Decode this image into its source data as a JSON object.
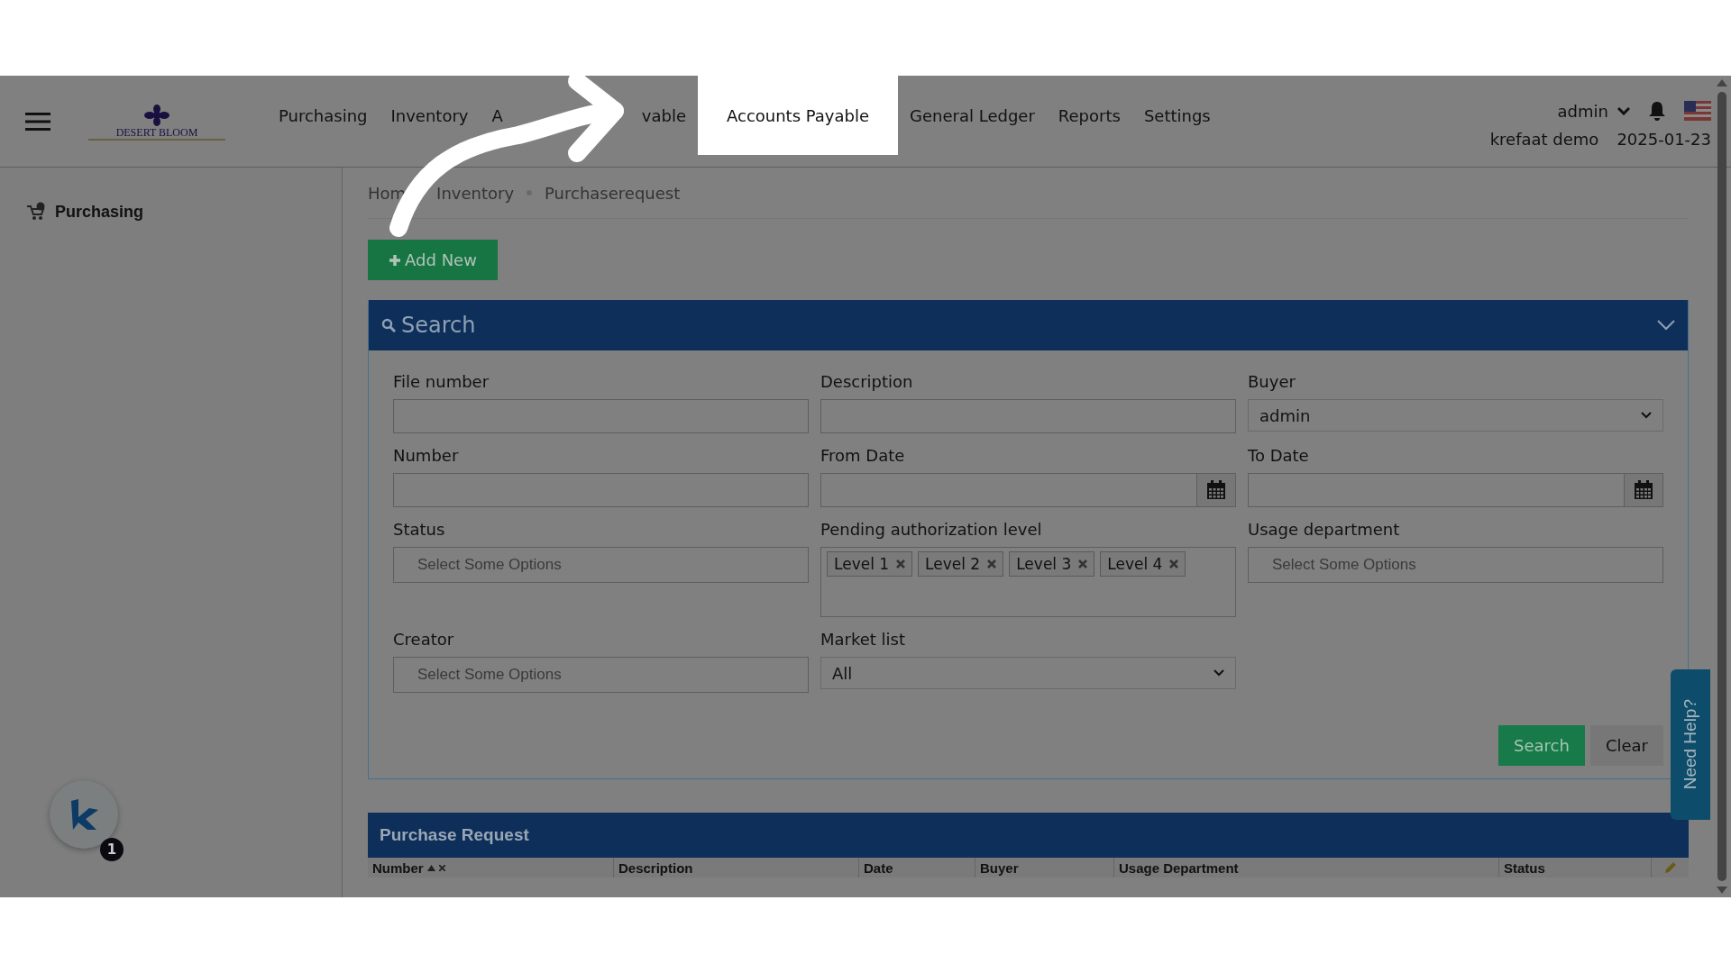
{
  "header": {
    "logo_text": "DESERT BLOOM",
    "nav": [
      {
        "kind": "item",
        "label": "Purchasing",
        "highlighted": false
      },
      {
        "kind": "item",
        "label": "Inventory",
        "highlighted": false
      },
      {
        "kind": "partial",
        "parts": [
          "A",
          "vable"
        ],
        "highlighted": false
      },
      {
        "kind": "item",
        "label": "Accounts Payable",
        "highlighted": true
      },
      {
        "kind": "item",
        "label": "General Ledger",
        "highlighted": false
      },
      {
        "kind": "item",
        "label": "Reports",
        "highlighted": false
      },
      {
        "kind": "item",
        "label": "Settings",
        "highlighted": false
      }
    ],
    "user": "admin",
    "company": "krefaat demo",
    "date": "2025-01-23"
  },
  "sidebar": {
    "items": [
      {
        "label": "Purchasing"
      }
    ],
    "widget_badge": "1"
  },
  "breadcrumb": [
    "Hom",
    "Inventory",
    "Purchaserequest"
  ],
  "add_button": "Add New",
  "search_panel": {
    "title": "Search",
    "fields": [
      {
        "label": "File number",
        "kind": "text"
      },
      {
        "label": "Description",
        "kind": "text"
      },
      {
        "label": "Buyer",
        "kind": "select",
        "value": "admin"
      },
      {
        "label": "Number",
        "kind": "text"
      },
      {
        "label": "From Date",
        "kind": "date"
      },
      {
        "label": "To Date",
        "kind": "date"
      },
      {
        "label": "Status",
        "kind": "multi",
        "placeholder": "Select Some Options"
      },
      {
        "label": "Pending authorization level",
        "kind": "tags",
        "tags": [
          "Level 1",
          "Level 2",
          "Level 3",
          "Level 4"
        ]
      },
      {
        "label": "Usage department",
        "kind": "multi",
        "placeholder": "Select Some Options"
      },
      {
        "label": "Creator",
        "kind": "multi",
        "placeholder": "Select Some Options"
      },
      {
        "label": "Market list",
        "kind": "select",
        "value": "All"
      }
    ],
    "buttons": [
      {
        "kind": "primary",
        "label": "Search"
      },
      {
        "kind": "secondary",
        "label": "Clear"
      }
    ]
  },
  "help_tab": "Need Help?",
  "table": {
    "title": "Purchase Request",
    "columns": [
      {
        "label": "Number",
        "sorted": true
      },
      {
        "label": "Description",
        "sorted": false
      },
      {
        "label": "Date",
        "sorted": false
      },
      {
        "label": "Buyer",
        "sorted": false
      },
      {
        "label": "Usage Department",
        "sorted": false
      },
      {
        "label": "Status",
        "sorted": false
      }
    ]
  }
}
